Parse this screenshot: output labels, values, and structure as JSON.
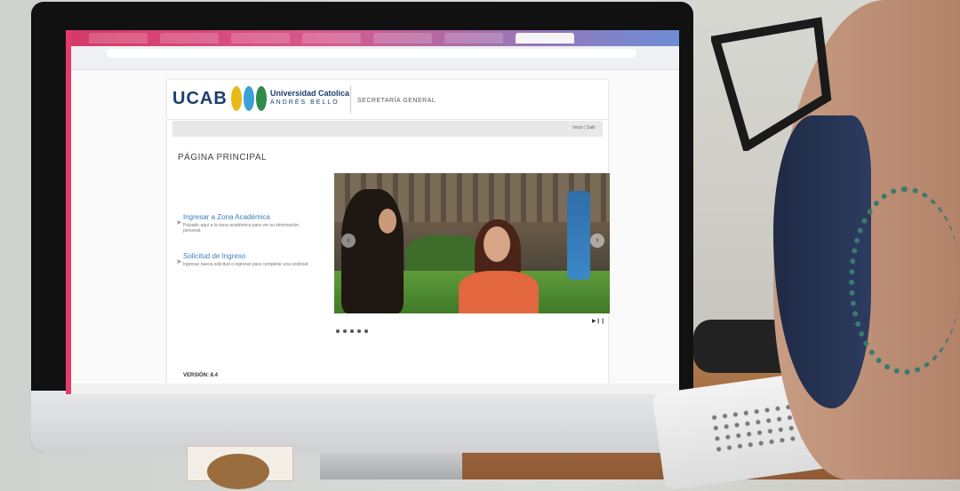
{
  "browser": {
    "tabs": [
      "",
      "",
      "",
      "",
      "",
      "",
      "",
      ""
    ],
    "active_tab_index": 7,
    "url": "",
    "colors": {
      "tabstrip_start": "#d43a68",
      "tabstrip_end": "#6c8dd6"
    }
  },
  "site": {
    "logo": "UCAB",
    "university_name": "Universidad Catolica",
    "university_sub": "ANDRÉS BELLO",
    "section": "SECRETARÍA GENERAL",
    "login_link": "Inicio | Salir",
    "page_title": "PÁGINA PRINCIPAL",
    "links": [
      {
        "title": "Ingresar a Zona Académica",
        "desc": "Pulsado aquí a la zona académica para ver su información personal."
      },
      {
        "title": "Solicitud de Ingreso",
        "desc": "Ingresar nueva solicitud o ingresar para completar una solicitud."
      }
    ],
    "slider": {
      "prev_icon": "chevron-left-icon",
      "next_icon": "chevron-right-icon",
      "dots": 5
    },
    "version": "VERSIÓN: 8.4",
    "colors": {
      "brand": "#1c3f6e",
      "link": "#3a7fc0"
    }
  },
  "device": {
    "logo_icon": "apple-logo-icon"
  }
}
